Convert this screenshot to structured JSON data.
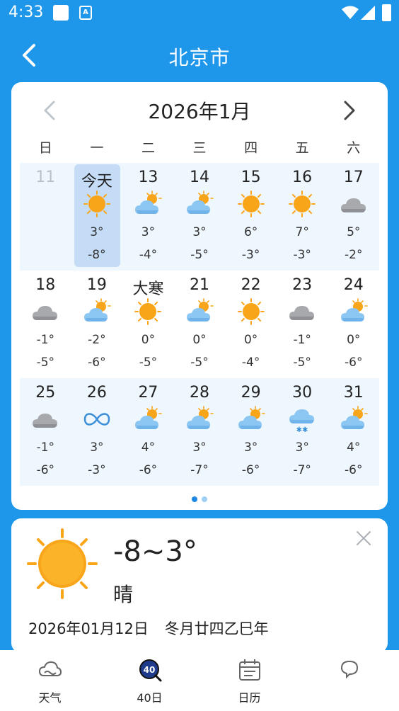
{
  "status": {
    "time": "4:33",
    "sim_badge": "A"
  },
  "header": {
    "title": "北京市"
  },
  "calendar": {
    "month_title": "2026年1月",
    "weekdays": [
      "日",
      "一",
      "二",
      "三",
      "四",
      "五",
      "六"
    ],
    "weeks": [
      [
        {
          "day": "11",
          "dim": true
        },
        {
          "day": "今天",
          "icon": "sun-icon",
          "hi": "3°",
          "lo": "-8°",
          "today": true
        },
        {
          "day": "13",
          "icon": "partly-cloudy-icon",
          "hi": "3°",
          "lo": "-4°"
        },
        {
          "day": "14",
          "icon": "partly-cloudy-icon",
          "hi": "3°",
          "lo": "-5°"
        },
        {
          "day": "15",
          "icon": "sun-icon",
          "hi": "6°",
          "lo": "-3°"
        },
        {
          "day": "16",
          "icon": "sun-icon",
          "hi": "7°",
          "lo": "-3°"
        },
        {
          "day": "17",
          "icon": "cloud-icon",
          "hi": "5°",
          "lo": "-2°"
        }
      ],
      [
        {
          "day": "18",
          "icon": "cloud-icon",
          "hi": "-1°",
          "lo": "-5°"
        },
        {
          "day": "19",
          "icon": "partly-cloudy-icon",
          "hi": "-2°",
          "lo": "-6°"
        },
        {
          "day": "大寒",
          "icon": "sun-icon",
          "hi": "0°",
          "lo": "-5°"
        },
        {
          "day": "21",
          "icon": "partly-cloudy-icon",
          "hi": "0°",
          "lo": "-5°"
        },
        {
          "day": "22",
          "icon": "sun-icon",
          "hi": "0°",
          "lo": "-4°"
        },
        {
          "day": "23",
          "icon": "cloud-icon",
          "hi": "-1°",
          "lo": "-5°"
        },
        {
          "day": "24",
          "icon": "partly-cloudy-icon",
          "hi": "0°",
          "lo": "-6°"
        }
      ],
      [
        {
          "day": "25",
          "icon": "cloud-icon",
          "hi": "-1°",
          "lo": "-6°"
        },
        {
          "day": "26",
          "icon": "haze-icon",
          "hi": "3°",
          "lo": "-3°"
        },
        {
          "day": "27",
          "icon": "partly-cloudy-icon",
          "hi": "4°",
          "lo": "-6°"
        },
        {
          "day": "28",
          "icon": "partly-cloudy-icon",
          "hi": "3°",
          "lo": "-7°"
        },
        {
          "day": "29",
          "icon": "partly-cloudy-icon",
          "hi": "3°",
          "lo": "-6°"
        },
        {
          "day": "30",
          "icon": "snow-icon",
          "hi": "3°",
          "lo": "-7°"
        },
        {
          "day": "31",
          "icon": "partly-cloudy-icon",
          "hi": "4°",
          "lo": "-6°"
        }
      ]
    ],
    "page_count": 2,
    "active_page": 1
  },
  "detail": {
    "range": "-8~3°",
    "condition": "晴",
    "date": "2026年01月12日",
    "lunar": "冬月廿四乙巳年"
  },
  "tabs": [
    {
      "label": "天气",
      "icon": "cloud-outline-icon"
    },
    {
      "label": "40日",
      "icon": "forty-day-icon"
    },
    {
      "label": "日历",
      "icon": "calendar-icon"
    },
    {
      "label": "",
      "icon": "chat-bubble-icon"
    }
  ],
  "colors": {
    "primary": "#1e96ea",
    "today_highlight": "#c4dcf5",
    "row_shade": "#eef6fe",
    "sun": "#f9a51a",
    "dot_active": "#1e88e5",
    "dot_inactive": "#9ecff5"
  }
}
